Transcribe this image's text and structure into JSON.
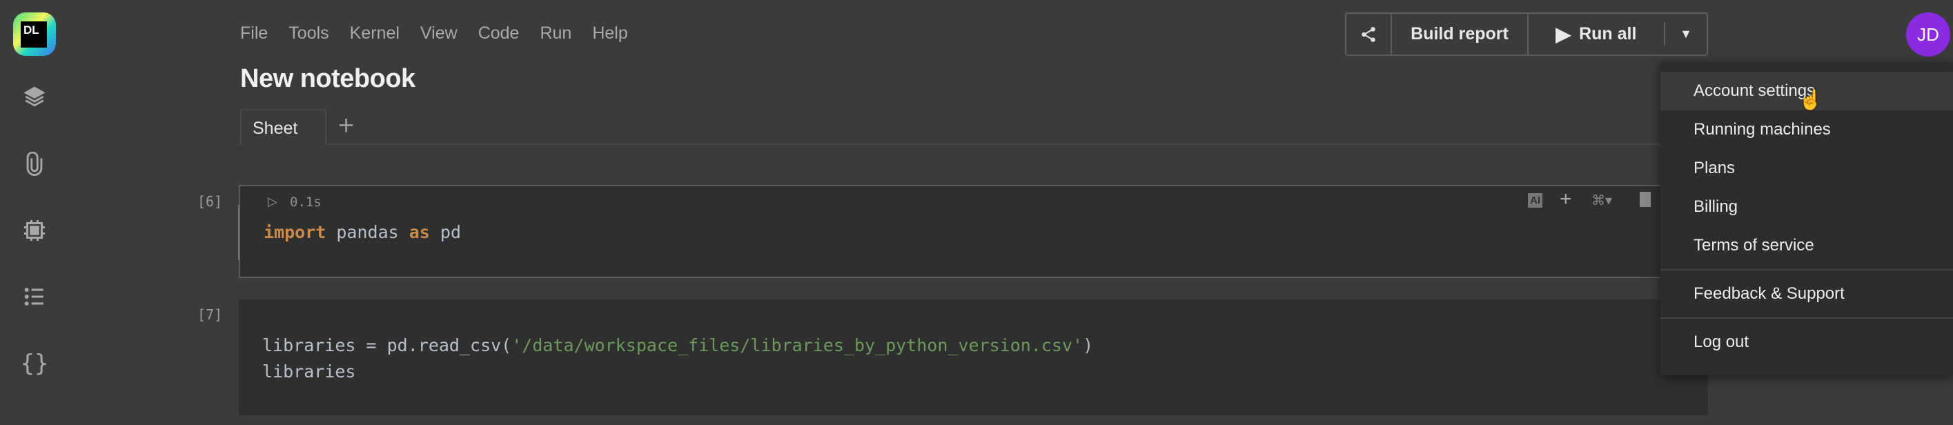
{
  "logo": {
    "text": "DL"
  },
  "sidebar": {
    "icons": [
      "layers-icon",
      "paperclip-icon",
      "chip-icon",
      "list-icon",
      "braces-icon"
    ]
  },
  "menu": [
    "File",
    "Tools",
    "Kernel",
    "View",
    "Code",
    "Run",
    "Help"
  ],
  "title": "New notebook",
  "tabs": {
    "active": "Sheet",
    "add": "+"
  },
  "cells": [
    {
      "exec": "[6]",
      "time": "0.1s",
      "code": {
        "kw1": "import",
        "t1": " pandas ",
        "kw2": "as",
        "t2": " pd"
      }
    },
    {
      "exec": "[7]",
      "line1": {
        "a": "libraries = pd.read_csv(",
        "s": "'/data/workspace_files/libraries_by_python_version.csv'",
        "b": ")"
      },
      "line2": "libraries"
    }
  ],
  "cell_toolbar": {
    "ai": "AI"
  },
  "toolbar": {
    "build_report": "Build report",
    "run_all": "Run all"
  },
  "avatar": "JD",
  "account_menu": {
    "items": [
      "Account settings",
      "Running machines",
      "Plans",
      "Billing",
      "Terms of service",
      "Feedback & Support",
      "Log out"
    ]
  },
  "colors": {
    "avatar": "#8a2be2",
    "keyword": "#cc8a4a",
    "string": "#6a9a5a"
  }
}
